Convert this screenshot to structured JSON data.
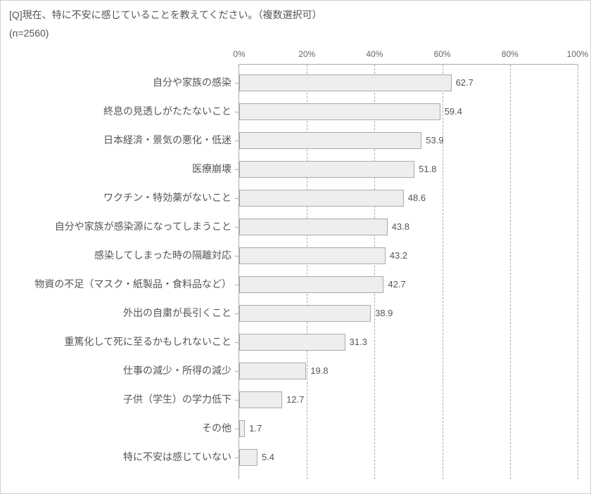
{
  "title": "[Q]現在、特に不安に感じていることを教えてください。（複数選択可）",
  "subtitle": "(n=2560)",
  "chart_data": {
    "type": "bar",
    "orientation": "horizontal",
    "xlabel": "",
    "ylabel": "",
    "xlim": [
      0,
      100
    ],
    "xticks": [
      0,
      20,
      40,
      60,
      80,
      100
    ],
    "xtick_labels": [
      "0%",
      "20%",
      "40%",
      "60%",
      "80%",
      "100%"
    ],
    "categories": [
      "自分や家族の感染",
      "終息の見透しがたたないこと",
      "日本経済・景気の悪化・低迷",
      "医療崩壊",
      "ワクチン・特効薬がないこと",
      "自分や家族が感染源になってしまうこと",
      "感染してしまった時の隔離対応",
      "物資の不足（マスク・紙製品・食料品など）",
      "外出の自粛が長引くこと",
      "重篤化して死に至るかもしれないこと",
      "仕事の減少・所得の減少",
      "子供（学生）の学力低下",
      "その他",
      "特に不安は感じていない"
    ],
    "values": [
      62.7,
      59.4,
      53.9,
      51.8,
      48.6,
      43.8,
      43.2,
      42.7,
      38.9,
      31.3,
      19.8,
      12.7,
      1.7,
      5.4
    ],
    "value_labels": [
      "62.7",
      "59.4",
      "53.9",
      "51.8",
      "48.6",
      "43.8",
      "43.2",
      "42.7",
      "38.9",
      "31.3",
      "19.8",
      "12.7",
      "1.7",
      "5.4"
    ]
  }
}
